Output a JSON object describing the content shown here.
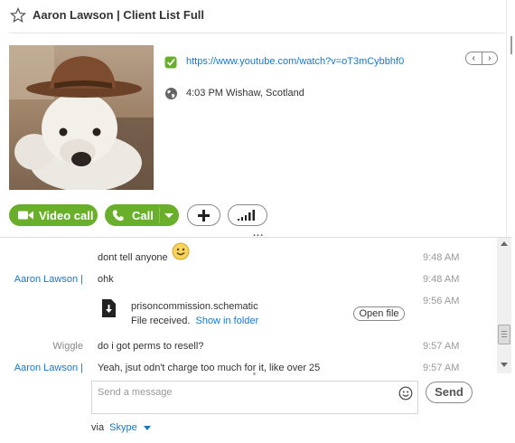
{
  "header": {
    "title": "Aaron Lawson | Client List Full"
  },
  "profile": {
    "mood_link": "https://www.youtube.com/watch?v=oT3mCybbhf0",
    "location": "4:03 PM Wishaw, Scotland",
    "nav_prev": "‹",
    "nav_next": "›"
  },
  "actions": {
    "video_call": "Video call",
    "call": "Call",
    "more": "..."
  },
  "messages": [
    {
      "sender": "",
      "text": "dont tell anyone",
      "time": "9:48 AM"
    },
    {
      "sender": "Aaron Lawson |",
      "text": "ohk",
      "time": "9:48 AM"
    },
    {
      "sender": "",
      "text": "",
      "time": "9:56 AM"
    },
    {
      "sender": "Wiggle",
      "text": "do i got perms to resell?",
      "time": "9:57 AM"
    },
    {
      "sender": "Aaron Lawson |",
      "text": "Yeah, jsut odn't charge too much for it, like over 25",
      "time": "9:57 AM"
    }
  ],
  "file_transfer": {
    "file_name": "prisoncommission.schematic",
    "status": "File received.",
    "show_in_folder": "Show in folder",
    "open_file": "Open file"
  },
  "composer": {
    "placeholder": "Send a message",
    "send": "Send",
    "via_label": "via",
    "via_service": "Skype"
  },
  "colors": {
    "accent_green": "#6aaf2b",
    "link_blue": "#1a76c5"
  },
  "icons": [
    "star-icon",
    "mood-check-icon",
    "globe-icon",
    "video-camera-icon",
    "phone-icon",
    "plus-icon",
    "signal-bars-icon",
    "smiley-icon",
    "file-download-icon",
    "emoticon-icon"
  ]
}
